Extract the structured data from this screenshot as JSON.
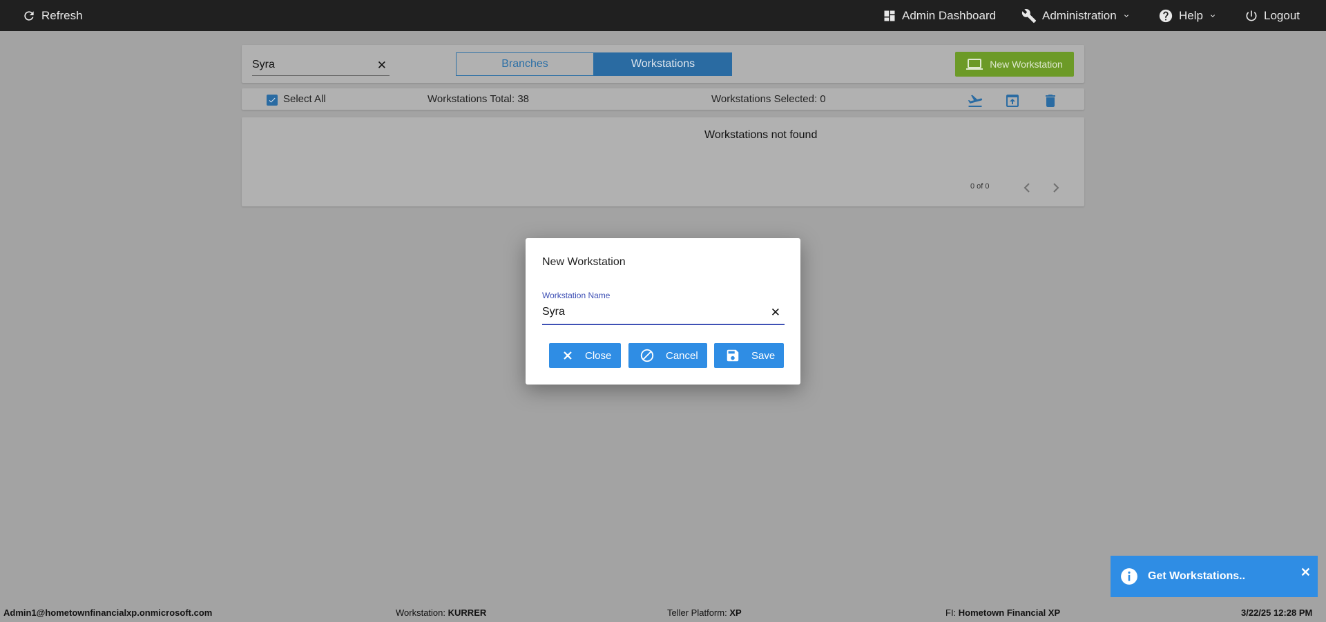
{
  "topbar": {
    "refresh": "Refresh",
    "admin_dashboard": "Admin Dashboard",
    "administration": "Administration",
    "help": "Help",
    "logout": "Logout"
  },
  "toolbar": {
    "search_value": "Syra",
    "tabs": [
      {
        "label": "Branches",
        "active": false
      },
      {
        "label": "Workstations",
        "active": true
      }
    ],
    "new_button": "New Workstation"
  },
  "selection": {
    "select_all": "Select All",
    "select_all_checked": true,
    "total": "Workstations Total: 38",
    "selected": "Workstations Selected: 0"
  },
  "list": {
    "empty_message": "Workstations not found",
    "pager": "0 of 0"
  },
  "modal": {
    "title": "New Workstation",
    "field_label": "Workstation Name",
    "field_value": "Syra",
    "buttons": {
      "close": "Close",
      "cancel": "Cancel",
      "save": "Save"
    }
  },
  "toast": {
    "message": "Get Workstations.."
  },
  "footer": {
    "user": "Admin1@hometownfinancialxp.onmicrosoft.com",
    "workstation_label": "Workstation:",
    "workstation_value": "KURRER",
    "platform_label": "Teller Platform:",
    "platform_value": "XP",
    "fi_label": "FI:",
    "fi_value": "Hometown Financial XP",
    "datetime": "3/22/25 12:28 PM"
  },
  "colors": {
    "topbar_bg": "#202020",
    "accent_blue": "#2f8de4",
    "new_button_green": "#6c9a27",
    "overlay_bg": "#a3a3a3",
    "field_underline": "#3f51b5"
  }
}
